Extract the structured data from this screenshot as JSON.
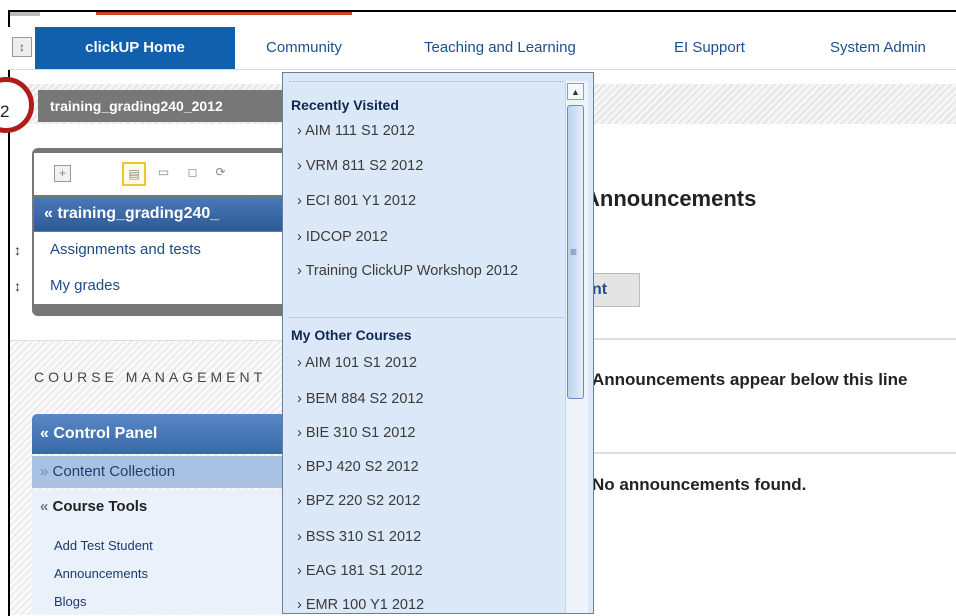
{
  "app": {
    "step_number": "2"
  },
  "nav": {
    "tabs": [
      {
        "label": "clickUP Home",
        "active": true
      },
      {
        "label": "Community"
      },
      {
        "label": "Teaching and Learning"
      },
      {
        "label": "EI Support"
      },
      {
        "label": "System Admin"
      }
    ]
  },
  "course": {
    "breadcrumb": "training_grading240_2012",
    "menu_title": "training_grading240_",
    "links": [
      "Assignments and tests",
      "My grades"
    ]
  },
  "course_management": {
    "label": "COURSE MANAGEMENT",
    "control_panel": "Control Panel",
    "content_collection": "Content Collection",
    "course_tools": "Course Tools",
    "tools": [
      "Add Test Student",
      "Announcements",
      "Blogs"
    ]
  },
  "main": {
    "title": "Announcements",
    "button_fragment": "nt",
    "note": "Announcements appear below this line",
    "empty": "No announcements found."
  },
  "dropdown": {
    "recent_heading": "Recently Visited",
    "recent": [
      "AIM 111 S1 2012",
      "VRM 811 S2 2012",
      "ECI 801 Y1 2012",
      "IDCOP 2012",
      "Training ClickUP Workshop 2012"
    ],
    "other_heading": "My Other Courses",
    "other": [
      "AIM 101 S1 2012",
      "BEM 884 S2 2012",
      "BIE 310 S1 2012",
      "BPJ 420 S2 2012",
      "BPZ 220 S2 2012",
      "BSS 310 S1 2012",
      "EAG 181 S1 2012",
      "EMR 100 Y1 2012"
    ]
  },
  "colors": {
    "nav_active": "#1060ad",
    "course_head": "#2d5a96",
    "dropdown_bg": "#dbe8f8",
    "badge_ring": "#b01c1c"
  }
}
